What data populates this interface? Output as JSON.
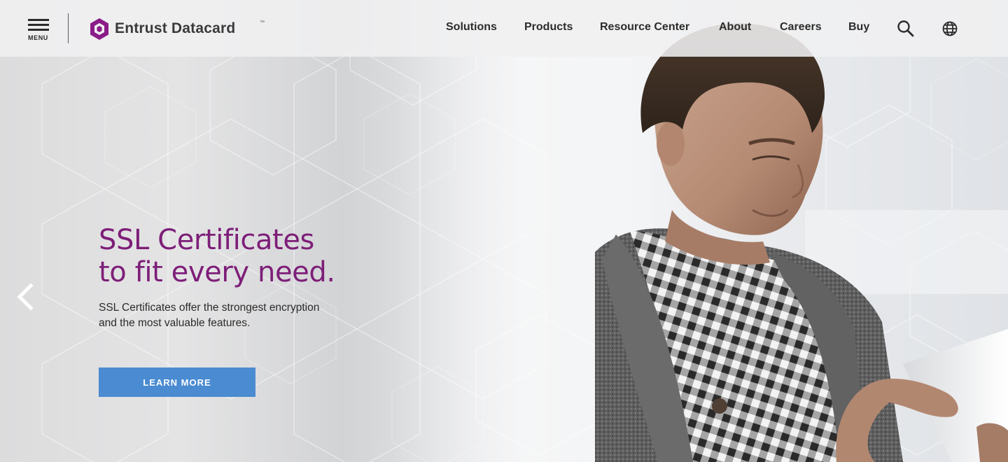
{
  "header": {
    "menu_label": "MENU",
    "brand": "Entrust Datacard",
    "brand_tm": "™",
    "brand_color": "#8a1c87",
    "nav": [
      {
        "label": "Solutions"
      },
      {
        "label": "Products"
      },
      {
        "label": "Resource Center"
      },
      {
        "label": "About"
      },
      {
        "label": "Careers"
      },
      {
        "label": "Buy"
      }
    ],
    "icons": [
      "search-icon",
      "globe-icon"
    ]
  },
  "hero": {
    "headline_line1": "SSL Certificates",
    "headline_line2": "to fit every need.",
    "headline_color": "#7d1e78",
    "description_line1": "SSL Certificates offer the strongest encryption",
    "description_line2": "and the most valuable features.",
    "cta_label": "LEARN MORE",
    "cta_color": "#4a8bd1",
    "prev_icon": "chevron-left-icon"
  }
}
